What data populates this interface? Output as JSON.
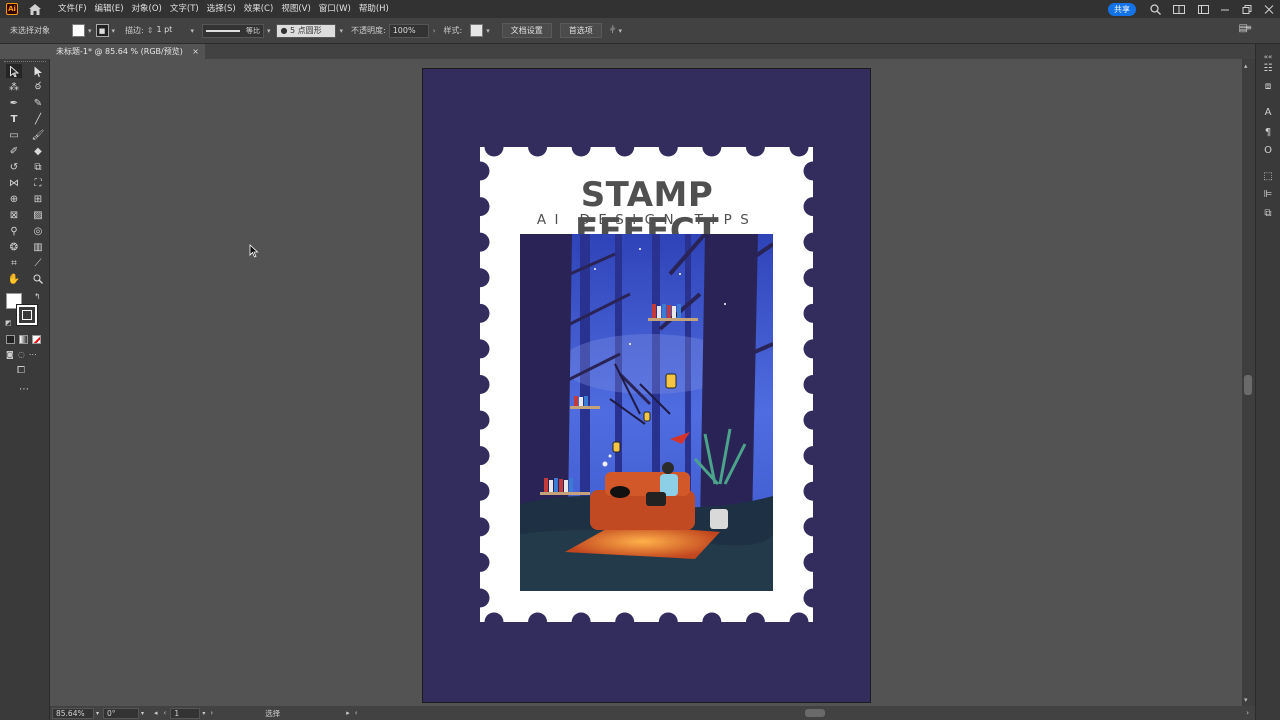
{
  "app": {
    "logo_text": "Ai",
    "menu": [
      "文件(F)",
      "编辑(E)",
      "对象(O)",
      "文字(T)",
      "选择(S)",
      "效果(C)",
      "视图(V)",
      "窗口(W)",
      "帮助(H)"
    ],
    "share_label": "共享"
  },
  "control_bar": {
    "selection_label": "未选择对象",
    "stroke_label": "描边:",
    "stroke_weight": "1 pt",
    "stroke_profile": "等比",
    "brush_label": "5 点圆形",
    "opacity_label": "不透明度:",
    "opacity_value": "100%",
    "style_label": "样式:",
    "doc_setup_button": "文档设置",
    "prefs_button": "首选项"
  },
  "document_tab": {
    "title": "未标题-1* @ 85.64 % (RGB/预览)",
    "close": "×"
  },
  "status_bar": {
    "zoom": "85.64%",
    "rotation": "0°",
    "artboard_number": "1",
    "mode_label": "选择"
  },
  "artwork": {
    "title": "STAMP EFFECT",
    "subtitle": "AI DESIGN TIPS",
    "colors": {
      "artboard": "#332d5e",
      "stamp": "#ffffff",
      "title_text": "#505050"
    }
  },
  "icons": [
    "home-icon",
    "search-icon",
    "arrange-icon",
    "window-minimize-icon",
    "window-restore-icon",
    "window-close-icon"
  ]
}
